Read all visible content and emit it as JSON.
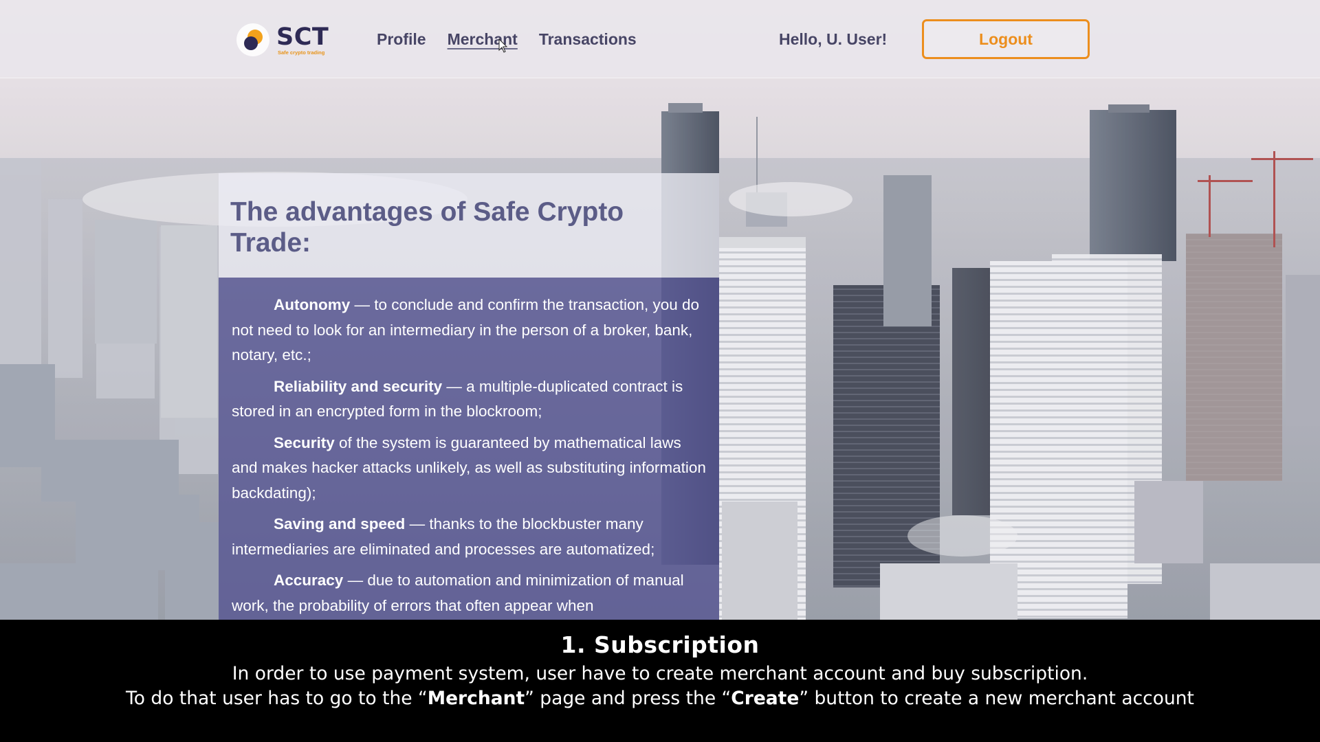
{
  "header": {
    "logo": {
      "name": "SCT",
      "tagline": "Safe crypto trading"
    },
    "nav": [
      {
        "label": "Profile",
        "active": false
      },
      {
        "label": "Merchant",
        "active": true
      },
      {
        "label": "Transactions",
        "active": false
      }
    ],
    "greeting": "Hello, U. User!",
    "logout_label": "Logout"
  },
  "card": {
    "title": "The advantages of Safe Crypto Trade:",
    "items": [
      {
        "term": "Autonomy",
        "text": " — to conclude and confirm the transaction, you do not need to look for an intermediary in the person of a broker, bank, notary, etc.;"
      },
      {
        "term": "Reliability and security",
        "text": " — a multiple-duplicated contract is stored in an encrypted form in the blockroom;"
      },
      {
        "term": "Security",
        "text": " of the system is guaranteed by mathematical laws and makes hacker attacks unlikely, as well as substituting information backdating);"
      },
      {
        "term": "Saving and speed",
        "text": " — thanks to the blockbuster many intermediaries are eliminated and processes are automatized;"
      },
      {
        "term": "Accuracy",
        "text": " — due to automation and minimization of manual work, the probability of errors that often appear when"
      }
    ]
  },
  "caption": {
    "title": "1. Subscription",
    "line1": "In order to use payment system, user have to create merchant account and buy subscription.",
    "line2": {
      "p1": "To do that user has to go to the “",
      "b1": "Merchant",
      "p2": "” page  and press the “",
      "b2": "Create",
      "p3": "” button to create a new merchant account"
    }
  },
  "colors": {
    "brand_dark": "#2e2a55",
    "accent_orange": "#ec8e1d",
    "card_body": "#525091"
  }
}
